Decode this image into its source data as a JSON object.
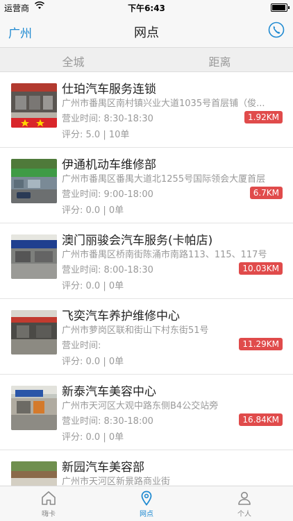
{
  "status_bar": {
    "carrier": "运营商",
    "time": "下午6:43"
  },
  "nav": {
    "city": "广州",
    "title": "网点"
  },
  "filters": {
    "all": "全城",
    "distance": "距离"
  },
  "shops": [
    {
      "name": "仕珀汽车服务连锁",
      "address": "广州市番禺区南村镇兴业大道1035号首层铺（俊...",
      "hours": "营业时间:   8:30-18:30",
      "rating": "评分:  5.0 | 10单",
      "distance": "1.92KM"
    },
    {
      "name": "伊通机动车维修部",
      "address": "广州市番禺区番禺大道北1255号国际领会大厦首层",
      "hours": "营业时间:   9:00-18:00",
      "rating": "评分:  0.0 | 0单",
      "distance": "6.7KM"
    },
    {
      "name": "澳门丽骏会汽车服务(卡帕店)",
      "address": "广州市番禺区桥南街陈涌市南路113、115、117号",
      "hours": "营业时间:   8:00-18:30",
      "rating": "评分:  0.0 | 0单",
      "distance": "10.03KM"
    },
    {
      "name": "飞奕汽车养护维修中心",
      "address": "广州市萝岗区联和街山下村东街51号",
      "hours": "营业时间:",
      "rating": "评分:  0.0 | 0单",
      "distance": "11.29KM"
    },
    {
      "name": "新泰汽车美容中心",
      "address": "广州市天河区大观中路东侧B4公交站旁",
      "hours": "营业时间:   8:30-18:00",
      "rating": "评分:  0.0 | 0单",
      "distance": "16.84KM"
    },
    {
      "name": "新园汽车美容部",
      "address": "广州市天河区新景路商业街",
      "hours": "",
      "rating": "",
      "distance": ""
    }
  ],
  "tabs": {
    "home": "嗨卡",
    "outlets": "网点",
    "profile": "个人"
  },
  "colors": {
    "accent": "#1f8ad1",
    "distance_badge": "#e04b4b"
  }
}
